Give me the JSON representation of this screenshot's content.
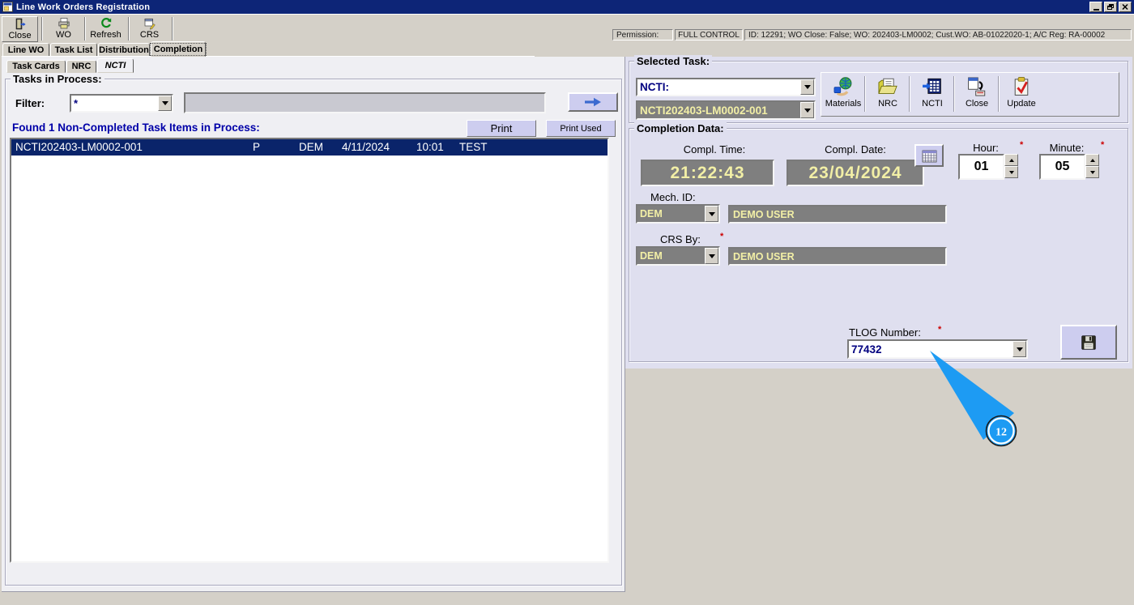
{
  "window": {
    "title": "Line Work Orders Registration"
  },
  "toolbar": {
    "close": "Close",
    "wo": "WO",
    "refresh": "Refresh",
    "crs": "CRS"
  },
  "permission": {
    "label": "Permission:",
    "level": "FULL CONTROL",
    "details": "ID: 12291; WO Close: False; WO: 202403-LM0002; Cust.WO: AB-01022020-1; A/C Reg: RA-00002"
  },
  "main_tabs": [
    {
      "label": "Line WO"
    },
    {
      "label": "Task List"
    },
    {
      "label": "Distribution"
    },
    {
      "label": "Completion"
    }
  ],
  "sub_tabs": [
    {
      "label": "Task Cards"
    },
    {
      "label": "NRC"
    },
    {
      "label": "NCTI"
    }
  ],
  "tasks_panel": {
    "title": "Tasks in Process:",
    "filter_label": "Filter:",
    "filter_value": "*",
    "found_text": "Found 1 Non-Completed Task Items in Process:",
    "print_button": "Print",
    "print_used_button": "Print Used",
    "row": {
      "task": "NCTI202403-LM0002-001",
      "flag": "P",
      "mech": "DEM",
      "date": "4/11/2024",
      "time": "10:01",
      "desc": "TEST"
    }
  },
  "selected_task": {
    "title": "Selected Task:",
    "ncti_value": "NCTI:",
    "task_value": "NCTI202403-LM0002-001",
    "buttons": [
      {
        "label": "Materials"
      },
      {
        "label": "NRC"
      },
      {
        "label": "NCTI"
      },
      {
        "label": "Close"
      },
      {
        "label": "Update"
      }
    ]
  },
  "completion": {
    "title": "Completion Data:",
    "time_label": "Compl. Time:",
    "time_value": "21:22:43",
    "date_label": "Compl. Date:",
    "date_value": "23/04/2024",
    "hour_label": "Hour:",
    "hour_value": "01",
    "minute_label": "Minute:",
    "minute_value": "05",
    "mech_label": "Mech. ID:",
    "mech_value": "DEM",
    "mech_name": "DEMO USER",
    "crs_label": "CRS By:",
    "crs_value": "DEM",
    "crs_name": "DEMO USER",
    "tlog_label": "TLOG Number:",
    "tlog_value": "77432",
    "required_marker": "*"
  },
  "annotation": {
    "step_number": "12"
  },
  "colors": {
    "titlebar": "#0d2577",
    "panel_right": "#dfdfef",
    "panel_left": "#efeff3",
    "selected_row": "#0a246a",
    "accent_button": "#cdcdef",
    "disabled_field_bg": "#7f7f7f",
    "disabled_field_text": "#f2efa6",
    "annotation_blue": "#1d9bf3",
    "required_red": "#cc0000",
    "navy_text": "#000080"
  }
}
